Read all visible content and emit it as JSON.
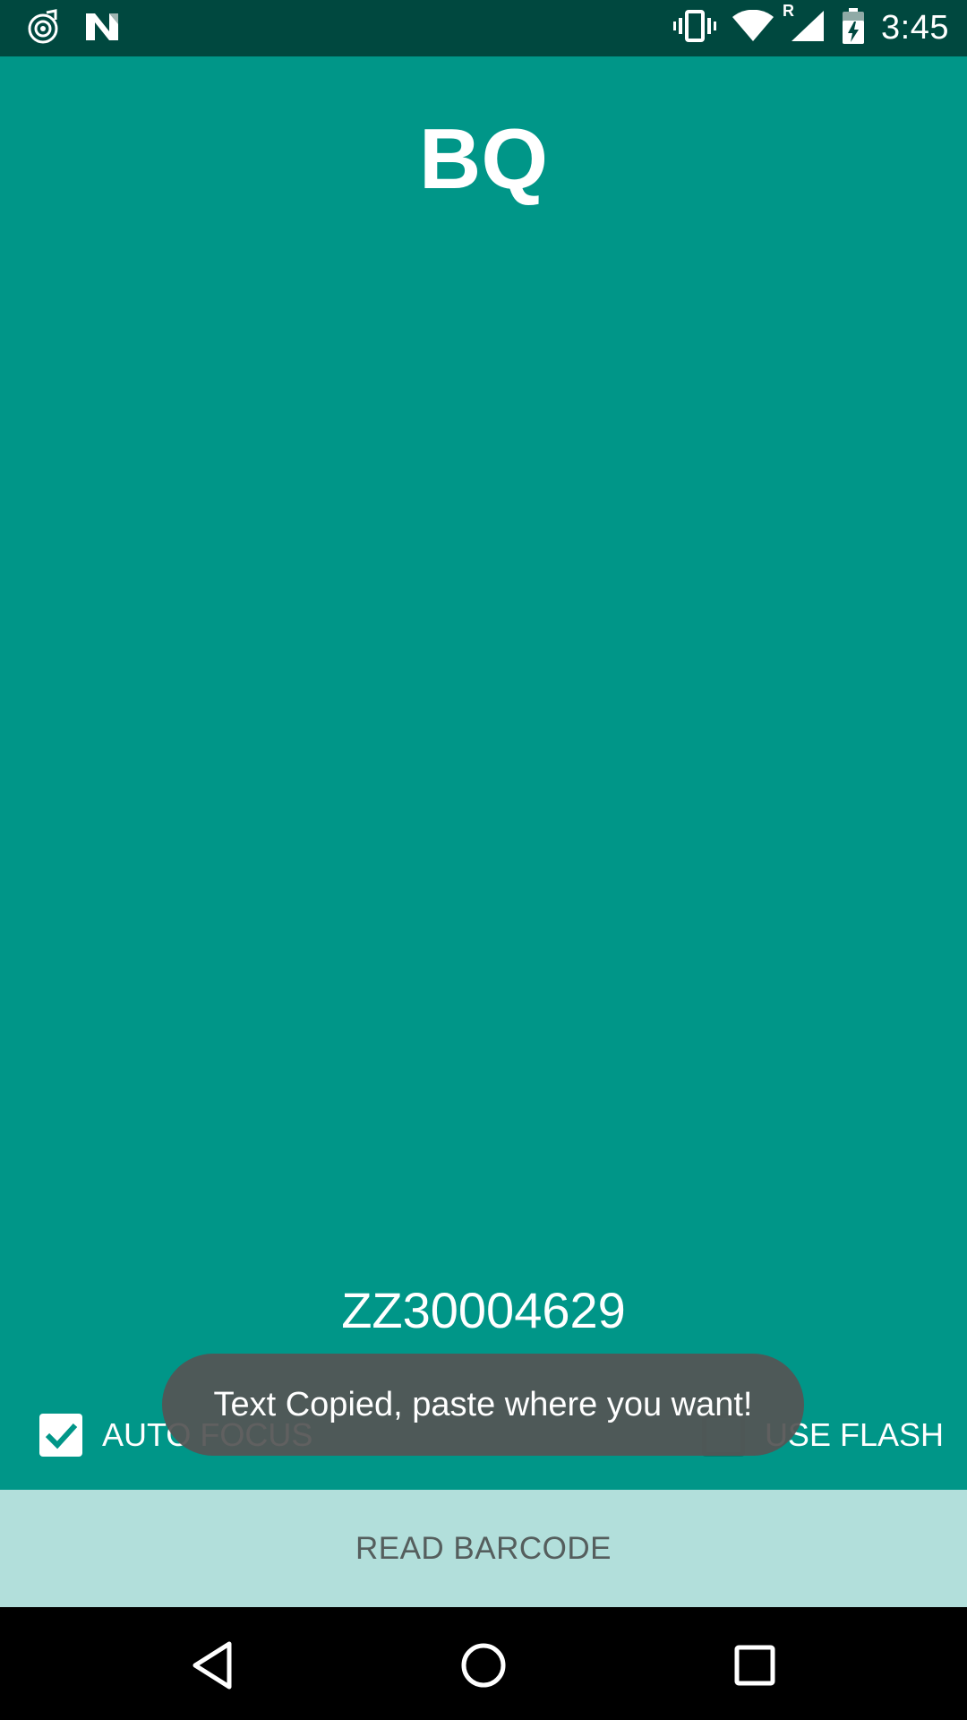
{
  "status_bar": {
    "time": "3:45",
    "left_icons": [
      "music-radar-icon",
      "n-logo-icon"
    ],
    "right_icons": [
      "vibrate-icon",
      "wifi-icon",
      "roaming-r-icon",
      "signal-icon",
      "battery-charging-icon"
    ],
    "roaming_label": "R"
  },
  "app": {
    "title": "BQ",
    "barcode_value": "ZZ30004629",
    "auto_focus": {
      "label": "AUTO FOCUS",
      "checked": true
    },
    "use_flash": {
      "label": "USE FLASH",
      "checked": false
    },
    "read_button_label": "READ BARCODE",
    "toast": "Text Copied, paste where you want!"
  },
  "nav_bar": {
    "buttons": [
      "back-icon",
      "home-icon",
      "recents-icon"
    ]
  },
  "colors": {
    "primary": "#009688",
    "status_bar": "#00483f",
    "button_bg": "#b2dfdb",
    "toast_bg": "#545454"
  }
}
